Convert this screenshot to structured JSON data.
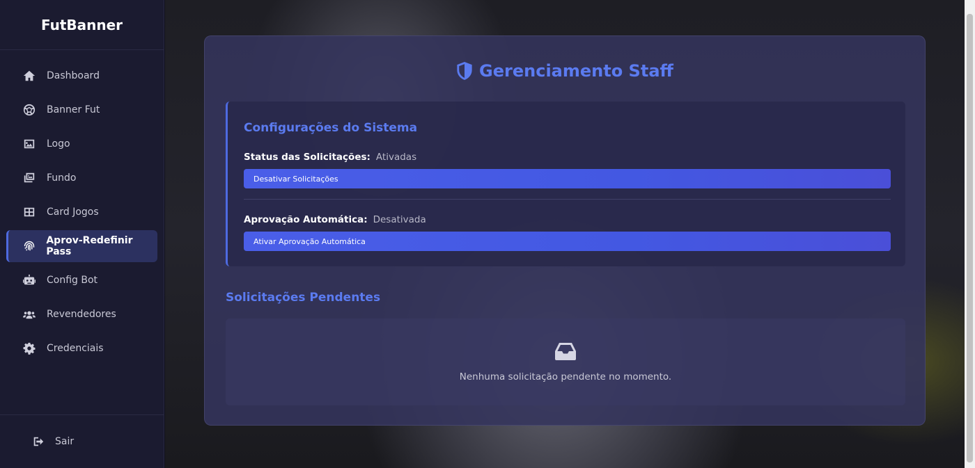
{
  "app": {
    "title": "FutBanner"
  },
  "sidebar": {
    "items": [
      {
        "label": "Dashboard",
        "icon": "home-icon"
      },
      {
        "label": "Banner Fut",
        "icon": "soccer-ball-icon"
      },
      {
        "label": "Logo",
        "icon": "image-icon"
      },
      {
        "label": "Fundo",
        "icon": "images-icon"
      },
      {
        "label": "Card Jogos",
        "icon": "grid-icon"
      },
      {
        "label": "Aprov-Redefinir Pass",
        "icon": "fingerprint-icon",
        "active": true
      },
      {
        "label": "Config Bot",
        "icon": "robot-icon"
      },
      {
        "label": "Revendedores",
        "icon": "users-icon"
      },
      {
        "label": "Credenciais",
        "icon": "gear-icon"
      }
    ],
    "logout_label": "Sair"
  },
  "main": {
    "title": "Gerenciamento Staff",
    "config": {
      "title": "Configurações do Sistema",
      "status_label": "Status das Solicitações:",
      "status_value": "Ativadas",
      "status_button": "Desativar Solicitações",
      "auto_label": "Aprovação Automática:",
      "auto_value": "Desativada",
      "auto_button": "Ativar Aprovação Automática"
    },
    "pending": {
      "title": "Solicitações Pendentes",
      "empty_text": "Nenhuma solicitação pendente no momento."
    }
  },
  "colors": {
    "accent": "#5b7bf0",
    "button": "#4a5ee8",
    "sidebar_bg": "#1b1b30",
    "panel_bg": "#34345c"
  }
}
